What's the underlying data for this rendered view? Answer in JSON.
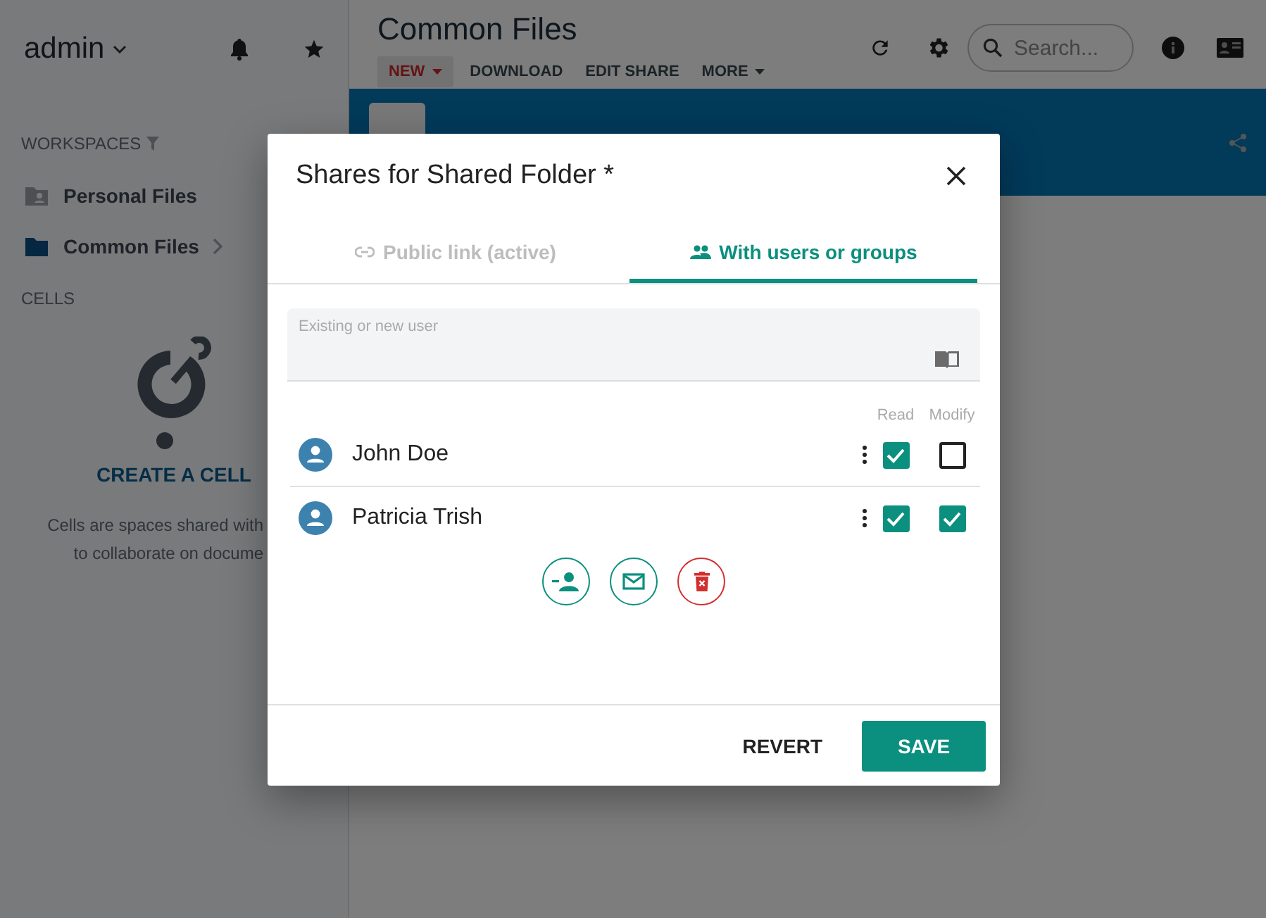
{
  "sidebar": {
    "user": "admin",
    "workspaces_heading": "WORKSPACES",
    "workspaces": [
      {
        "label": "Personal Files",
        "selected": false
      },
      {
        "label": "Common Files",
        "selected": true
      }
    ],
    "cells_heading": "CELLS",
    "create_cell": "CREATE A CELL",
    "cells_description": [
      "Cells are spaces shared with",
      "to collaborate on docume"
    ]
  },
  "header": {
    "title": "Common Files",
    "toolbar": [
      {
        "label": "NEW",
        "kind": "primary"
      },
      {
        "label": "DOWNLOAD",
        "kind": "plain"
      },
      {
        "label": "EDIT SHARE",
        "kind": "plain"
      },
      {
        "label": "MORE",
        "kind": "menu"
      }
    ],
    "search": {
      "placeholder": "Search..."
    }
  },
  "dialog": {
    "title": "Shares for Shared Folder *",
    "tabs": [
      {
        "label": "Public link (active)",
        "selected": false
      },
      {
        "label": "With users or groups",
        "selected": true
      }
    ],
    "user_field": {
      "placeholder": "Existing or new user"
    },
    "columns": [
      "Read",
      "Modify"
    ],
    "users": [
      {
        "name": "John Doe",
        "read": true,
        "modify": false
      },
      {
        "name": "Patricia Trish",
        "read": true,
        "modify": true
      }
    ],
    "buttons": [
      {
        "label": "REVERT",
        "kind": "text"
      },
      {
        "label": "SAVE",
        "kind": "raised"
      }
    ]
  }
}
